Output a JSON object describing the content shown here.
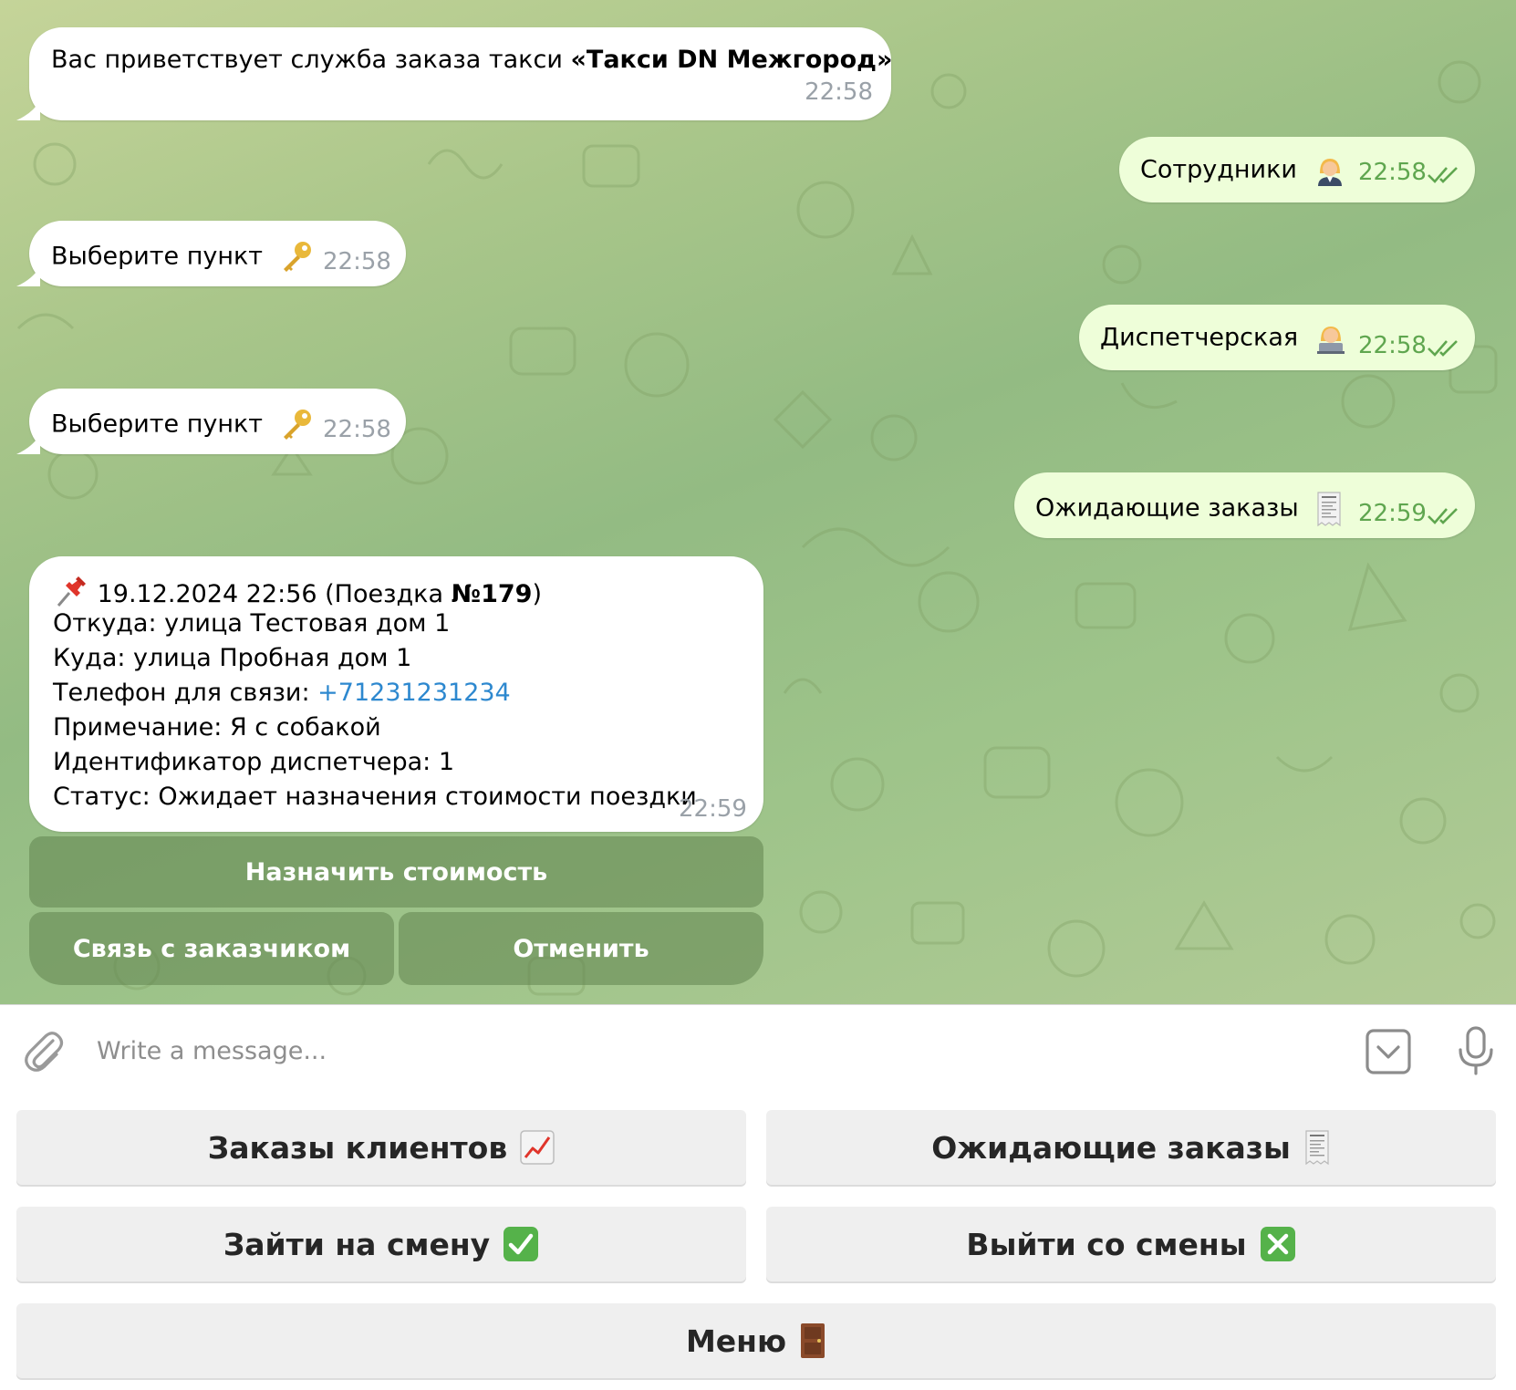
{
  "messages": {
    "greeting": {
      "text_prefix": "Вас приветствует служба заказа такси ",
      "text_bold": "«Такси DN Межгород»",
      "time": "22:58"
    },
    "out_staff": {
      "text": "Сотрудники",
      "emoji": "woman-office-worker",
      "time": "22:58"
    },
    "in_choose_1": {
      "text": "Выберите пункт",
      "emoji": "key",
      "time": "22:58"
    },
    "out_dispatch": {
      "text": "Диспетчерская",
      "emoji": "woman-technologist",
      "time": "22:58"
    },
    "in_choose_2": {
      "text": "Выберите пункт",
      "emoji": "key",
      "time": "22:58"
    },
    "out_pending": {
      "text": "Ожидающие заказы",
      "emoji": "receipt",
      "time": "22:59"
    }
  },
  "order": {
    "pin_emoji": "pushpin",
    "header_prefix": " 19.12.2024 22:56 (Поездка ",
    "trip_number": "№179",
    "header_suffix": ")",
    "from": "Откуда: улица Тестовая дом 1",
    "to": "Куда: улица Пробная дом 1",
    "phone_label": "Телефон для связи: ",
    "phone": "+71231231234",
    "note": "Примечание: Я с собакой",
    "dispatcher_id": "Идентификатор диспетчера: 1",
    "status": "Статус: Ожидает назначения стоимости поездки",
    "time": "22:59",
    "buttons": {
      "set_price": "Назначить стоимость",
      "contact": "Связь с заказчиком",
      "cancel": "Отменить"
    }
  },
  "composer": {
    "placeholder": "Write a message...",
    "attach_icon": "paperclip-icon",
    "commands_icon": "bot-commands-icon",
    "mic_icon": "microphone-icon"
  },
  "keyboard": {
    "client_orders": {
      "label": "Заказы клиентов",
      "emoji": "chart-increasing"
    },
    "pending_orders": {
      "label": "Ожидающие заказы",
      "emoji": "receipt"
    },
    "start_shift": {
      "label": "Зайти на смену",
      "emoji": "check-mark-button"
    },
    "end_shift": {
      "label": "Выйти со смены",
      "emoji": "cross-mark-button"
    },
    "menu": {
      "label": "Меню",
      "emoji": "door"
    }
  },
  "colors": {
    "incoming_bubble": "#ffffff",
    "outgoing_bubble": "#eefed9",
    "outgoing_time": "#5fa64f",
    "link": "#2d88cf",
    "keyboard_button": "#efefef"
  }
}
